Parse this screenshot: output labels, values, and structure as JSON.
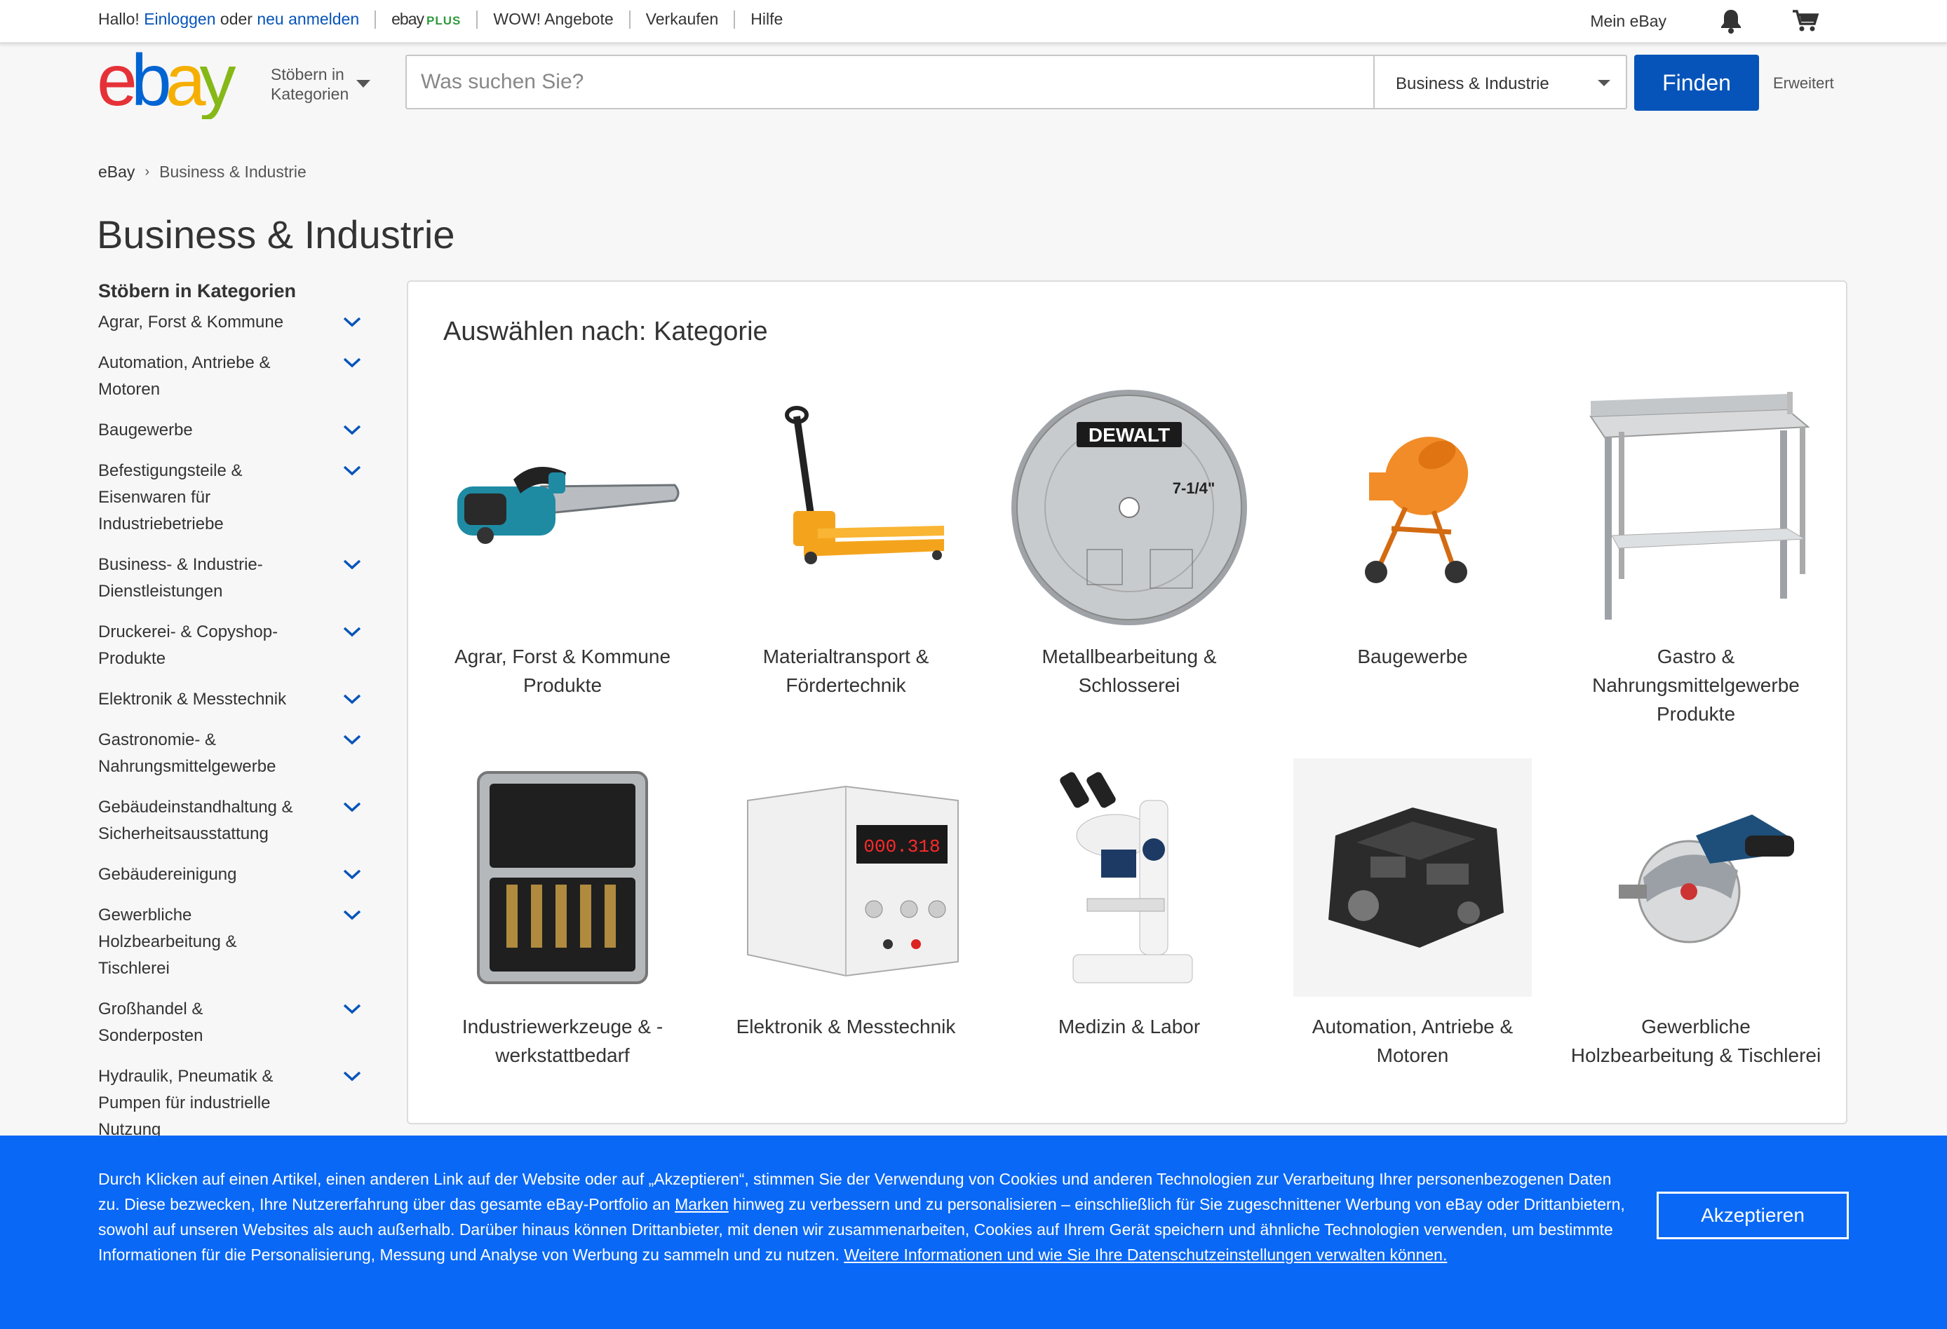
{
  "topbar": {
    "greeting": "Hallo!",
    "login": "Einloggen",
    "or": "oder",
    "register": "neu anmelden",
    "plus_logo": "ebay",
    "plus_tag": "PLUS",
    "links": [
      "WOW! Angebote",
      "Verkaufen",
      "Hilfe"
    ],
    "my_ebay": "Mein eBay"
  },
  "header": {
    "logo_text": "ebay",
    "browse_line1": "Stöbern in",
    "browse_line2": "Kategorien",
    "search_placeholder": "Was suchen Sie?",
    "category_selected": "Business & Industrie",
    "find_button": "Finden",
    "advanced": "Erweitert"
  },
  "breadcrumb": {
    "home": "eBay",
    "separator": "›",
    "current": "Business & Industrie"
  },
  "page_title": "Business & Industrie",
  "sidebar": {
    "heading": "Stöbern in Kategorien",
    "items": [
      "Agrar, Forst & Kommune",
      "Automation, Antriebe & Motoren",
      "Baugewerbe",
      "Befestigungsteile & Eisenwaren für Industriebetriebe",
      "Business- & Industrie-Dienstleistungen",
      "Druckerei- & Copyshop-Produkte",
      "Elektronik & Messtechnik",
      "Gastronomie- & Nahrungsmittelgewerbe",
      "Gebäudeinstandhaltung & Sicherheitsausstattung",
      "Gebäudereinigung",
      "Gewerbliche Holzbearbeitung & Tischlerei",
      "Großhandel & Sonderposten",
      "Hydraulik, Pneumatik & Pumpen für industrielle Nutzung"
    ]
  },
  "main": {
    "heading": "Auswählen nach: Kategorie",
    "tiles": [
      {
        "label": "Agrar, Forst & Kommune Produkte",
        "icon": "chainsaw-image"
      },
      {
        "label": "Materialtransport & Fördertechnik",
        "icon": "pallet-truck-image"
      },
      {
        "label": "Metallbearbeitung & Schlosserei",
        "icon": "saw-blade-image"
      },
      {
        "label": "Baugewerbe",
        "icon": "cement-mixer-image"
      },
      {
        "label": "Gastro & Nahrungsmittelgewerbe Produkte",
        "icon": "steel-table-image"
      },
      {
        "label": "Industriewerkzeuge & -werkstattbedarf",
        "icon": "drill-bit-case-image"
      },
      {
        "label": "Elektronik & Messtechnik",
        "icon": "power-supply-image"
      },
      {
        "label": "Medizin & Labor",
        "icon": "microscope-image"
      },
      {
        "label": "Automation, Antriebe & Motoren",
        "icon": "engine-image"
      },
      {
        "label": "Gewerbliche Holzbearbeitung & Tischlerei",
        "icon": "circular-saw-image"
      }
    ],
    "saw_blade_brand": "DEWALT",
    "saw_blade_size": "7-1/4\"",
    "power_supply_display": "000.318"
  },
  "cookie": {
    "text_part1": "Durch Klicken auf einen Artikel, einen anderen Link auf der Website oder auf „Akzeptieren“, stimmen Sie der Verwendung von Cookies und anderen Technologien zur Verarbeitung Ihrer personenbezogenen Daten zu. Diese bezwecken, Ihre Nutzererfahrung über das gesamte eBay-Portfolio an ",
    "link_brands": "Marken",
    "text_part2": " hinweg zu verbessern und zu personalisieren – einschließlich für Sie zugeschnittener Werbung von eBay oder Drittanbietern, sowohl auf unseren Websites als auch außerhalb. Darüber hinaus können Drittanbieter, mit denen wir zusammenarbeiten, Cookies auf Ihrem Gerät speichern und ähnliche Technologien verwenden, um bestimmte Informationen für die Personalisierung, Messung und Analyse von Werbung zu sammeln und zu nutzen. ",
    "link_more": "Weitere Informationen und wie Sie Ihre Datenschutzeinstellungen verwalten können.",
    "accept": "Akzeptieren"
  },
  "colors": {
    "brand_blue": "#0654ba",
    "cookie_blue": "#0968f6",
    "logo_red": "#e53238",
    "logo_blue": "#0064d2",
    "logo_yellow": "#f5af02",
    "logo_green": "#86b817"
  }
}
